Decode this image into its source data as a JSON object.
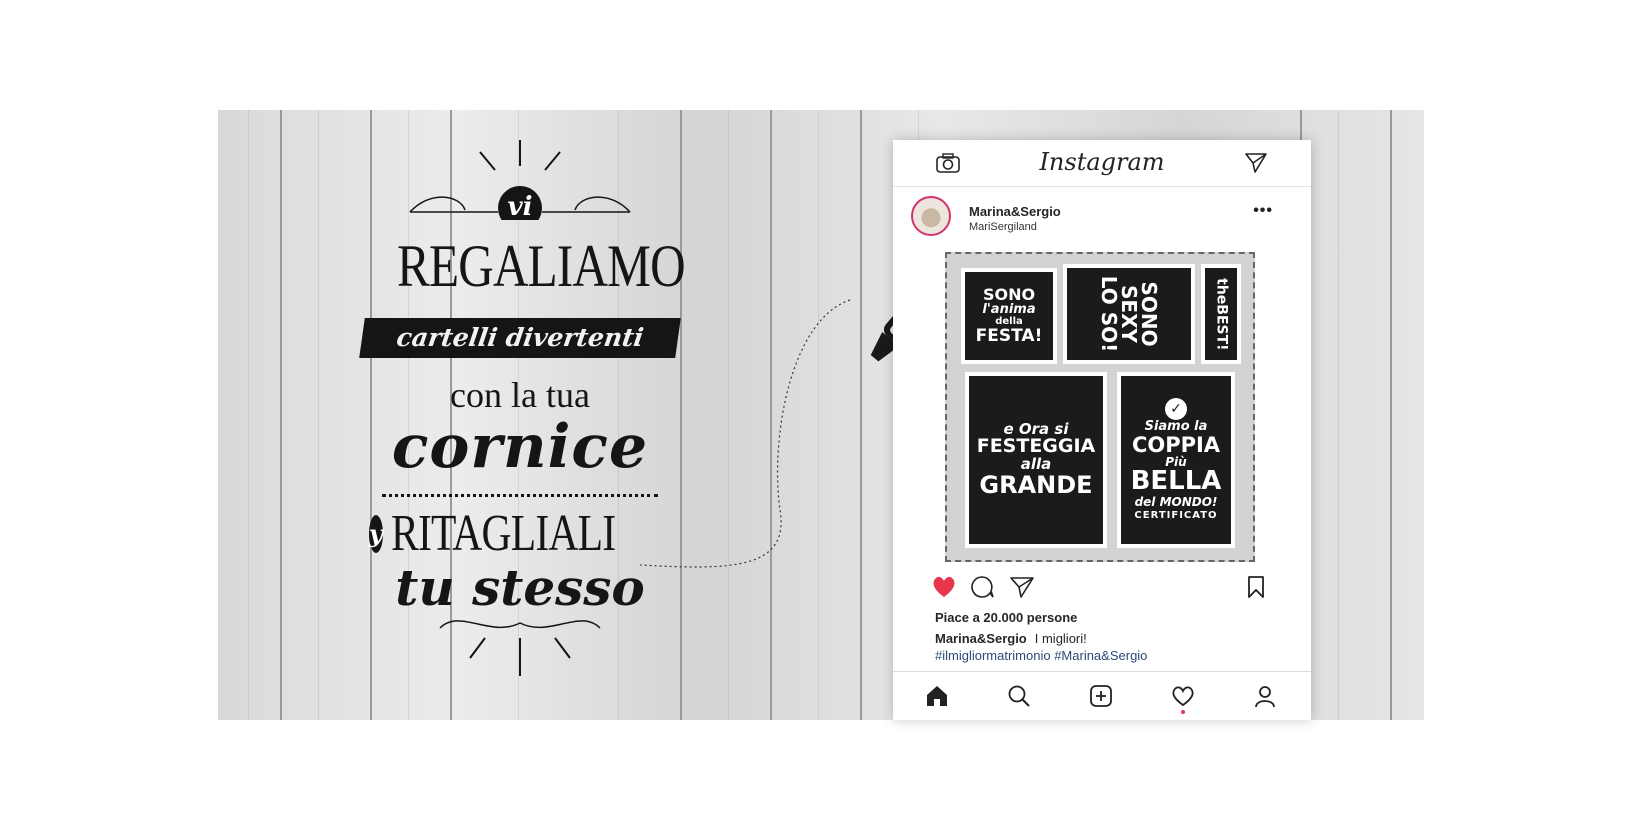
{
  "poster": {
    "vi": "vi",
    "line1": "REGALIAMO",
    "line2": "cartelli divertenti",
    "line3": "con la tua",
    "line4": "cornice",
    "amp": "y",
    "line5": "RITAGLIALI",
    "line6": "tu stesso"
  },
  "instagram": {
    "brand": "Instagram",
    "username": "Marina&Sergio",
    "handle": "MariSergiland",
    "more": "•••",
    "likes": "Piace a 20.000 persone",
    "caption_user": "Marina&Sergio",
    "caption_text": "I migliori!",
    "hashtags": "#ilmigliormatrimonio #Marina&Sergio",
    "like_color": "#e8364d"
  },
  "signs": {
    "s1_l1": "SONO",
    "s1_l2": "l'anima",
    "s1_l3": "della",
    "s1_l4": "FESTA!",
    "s2_l1": "SONO",
    "s2_l2": "SEXY",
    "s2_l3": "LO",
    "s2_l4": "SO!",
    "s3": "theBEST!",
    "s4_l1": "e Ora si",
    "s4_l2": "FESTEGGIA",
    "s4_l3": "alla",
    "s4_l4": "GRANDE",
    "s5_l1": "Siamo la",
    "s5_l2": "COPPIA",
    "s5_l3": "Più",
    "s5_l4": "BELLA",
    "s5_l5": "del MONDO!",
    "s5_l6": "CERTIFICATO"
  },
  "icons": [
    "camera-icon",
    "send-icon",
    "heart-icon",
    "comment-icon",
    "share-icon",
    "bookmark-icon",
    "home-icon",
    "search-icon",
    "add-icon",
    "activity-icon",
    "profile-icon",
    "marker-pen-icon"
  ]
}
